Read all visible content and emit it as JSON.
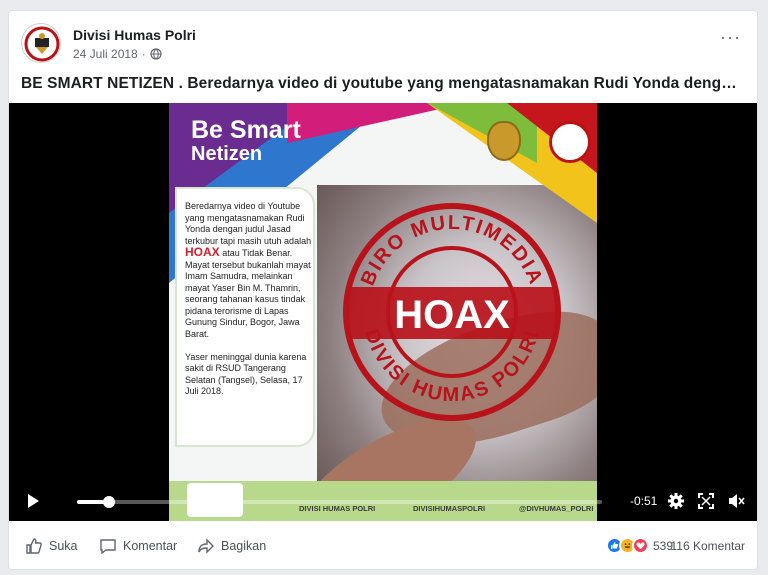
{
  "post": {
    "page_name": "Divisi Humas Polri",
    "date": "24 Juli 2018",
    "privacy_dot": "·",
    "more_label": "···",
    "text": "BE SMART NETIZEN . Beredarnya video di youtube yang mengatasnamakan Rudi Yonda dengan..."
  },
  "video": {
    "title_line1": "Be Smart",
    "title_line2": "Netizen",
    "panel_text_before": "Beredarnya video di Youtube yang mengatasnamakan Rudi Yonda dengan judul Jasad terkubur tapi masih utuh adalah",
    "panel_hoax_word": "HOAX",
    "panel_text_after": "atau Tidak Benar. Mayat tersebut bukanlah mayat Imam Samudra, melainkan mayat Yaser Bin M. Thamrin, seorang tahanan kasus tindak pidana terorisme di Lapas Gunung Sindur, Bogor, Jawa Barat.",
    "panel_text_para2": "Yaser meninggal dunia karena sakit di RSUD Tangerang Selatan (Tangsel), Selasa, 17 Juli 2018.",
    "stamp_top": "BIRO MULTIMEDIA",
    "stamp_center": "HOAX",
    "stamp_bottom": "DIVISI HUMAS POLRI",
    "footer_fb": "DIVISI HUMAS POLRI",
    "footer_ig": "DIVISIHUMASPOLRI",
    "footer_tw": "@DIVHUMAS_POLRI",
    "time_remaining": "-0:51",
    "progress": 0.06
  },
  "actions": {
    "like": "Suka",
    "comment": "Komentar",
    "share": "Bagikan",
    "reaction_count": "539",
    "comments_count": "116 Komentar"
  },
  "colors": {
    "fb_blue": "#1877f2",
    "love_red": "#f33e58",
    "haha_yellow": "#f7b125"
  }
}
